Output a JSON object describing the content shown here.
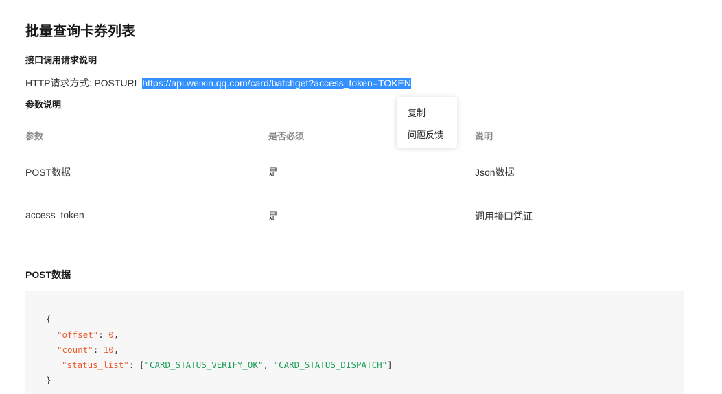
{
  "page": {
    "title": "批量查询卡券列表"
  },
  "api_section": {
    "heading": "接口调用请求说明",
    "http_prefix": "HTTP请求方式: POSTURL:",
    "url": "https://api.weixin.qq.com/card/batchget?access_token=TOKEN",
    "url_selected": true
  },
  "params_section": {
    "heading": "参数说明",
    "columns": [
      "参数",
      "是否必须",
      "说明"
    ],
    "rows": [
      {
        "param": "POST数据",
        "required": "是",
        "desc": "Json数据"
      },
      {
        "param": "access_token",
        "required": "是",
        "desc": "调用接口凭证"
      }
    ]
  },
  "context_menu": {
    "items": [
      "复制",
      "问题反馈"
    ]
  },
  "post_section": {
    "heading": "POST数据",
    "code": {
      "open_brace": "{",
      "offset_key": "\"offset\"",
      "offset_value": "0",
      "count_key": "\"count\"",
      "count_value": "10",
      "status_list_key": "\"status_list\"",
      "status_list_values": [
        "\"CARD_STATUS_VERIFY_OK\"",
        "\"CARD_STATUS_DISPATCH\""
      ],
      "close_brace": "}"
    }
  },
  "colors": {
    "selection": "#3390ff",
    "code_key": "#e85a2c",
    "code_string": "#1aa05a",
    "code_background": "#f7f7f7"
  }
}
